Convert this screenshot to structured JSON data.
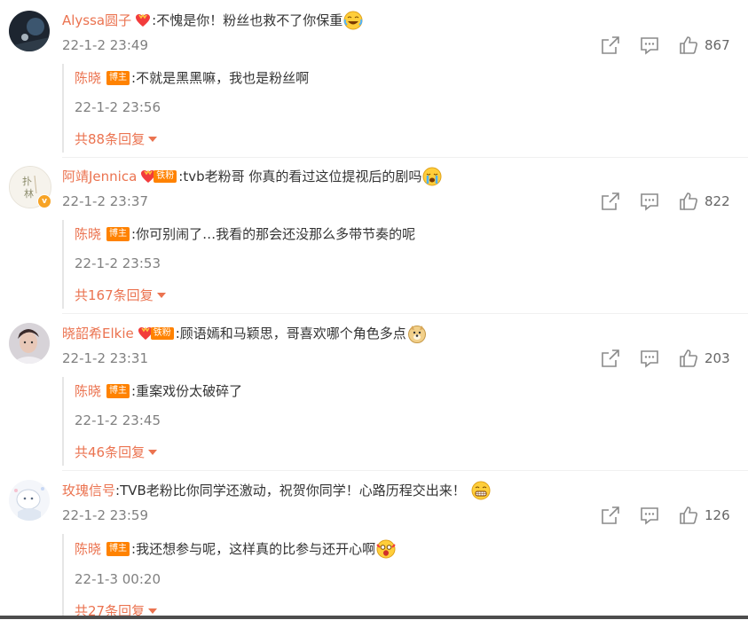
{
  "comments": [
    {
      "username": "Alyssa圆子",
      "text": ":不愧是你！粉丝也救不了你保重",
      "time": "22-1-2 23:49",
      "likes": "867",
      "has_fan_badge": false,
      "avatar": "dark-stage-avatar",
      "emoji": "laugh-cry-emoji",
      "reply": {
        "author": "陈晓",
        "badge": "博主",
        "text": ":不就是黑黑嘛，我也是粉丝啊",
        "time": "22-1-2 23:56",
        "emoji": ""
      },
      "more": "共88条回复"
    },
    {
      "username": "阿靖Jennica",
      "fan_badge": "铁粉",
      "text": ":tvb老粉哥 你真的看过这位提视后的剧吗",
      "time": "22-1-2 23:37",
      "likes": "822",
      "avatar": "handwriting-avatar",
      "emoji": "crying-emoji",
      "reply": {
        "author": "陈晓",
        "badge": "博主",
        "text": ":你可别闹了…我看的那会还没那么多带节奏的呢",
        "time": "22-1-2 23:53",
        "emoji": ""
      },
      "more": "共167条回复"
    },
    {
      "username": "晓韶希Elkie",
      "fan_badge": "铁粉",
      "text": ":顾语嫣和马颖思，哥喜欢哪个角色多点",
      "time": "22-1-2 23:31",
      "likes": "203",
      "avatar": "photo-avatar",
      "emoji": "doge-emoji",
      "reply": {
        "author": "陈晓",
        "badge": "博主",
        "text": ":重案戏份太破碎了",
        "time": "22-1-2 23:45",
        "emoji": ""
      },
      "more": "共46条回复"
    },
    {
      "username": "玫瑰信号",
      "text": ":TVB老粉比你同学还激动，祝贺你同学！心路历程交出来！",
      "time": "22-1-2 23:59",
      "likes": "126",
      "avatar": "cartoon-avatar",
      "emoji": "grin-emoji",
      "reply": {
        "author": "陈晓",
        "badge": "博主",
        "text": ":我还想参与呢，这样真的比参与还开心啊",
        "time": "22-1-3 00:20",
        "emoji": "shocked-emoji"
      },
      "more": "共27条回复"
    }
  ],
  "colors": {
    "username": "#eb7350",
    "badge": "#ff8200",
    "time": "#808080",
    "icon": "#8a8a8a"
  }
}
